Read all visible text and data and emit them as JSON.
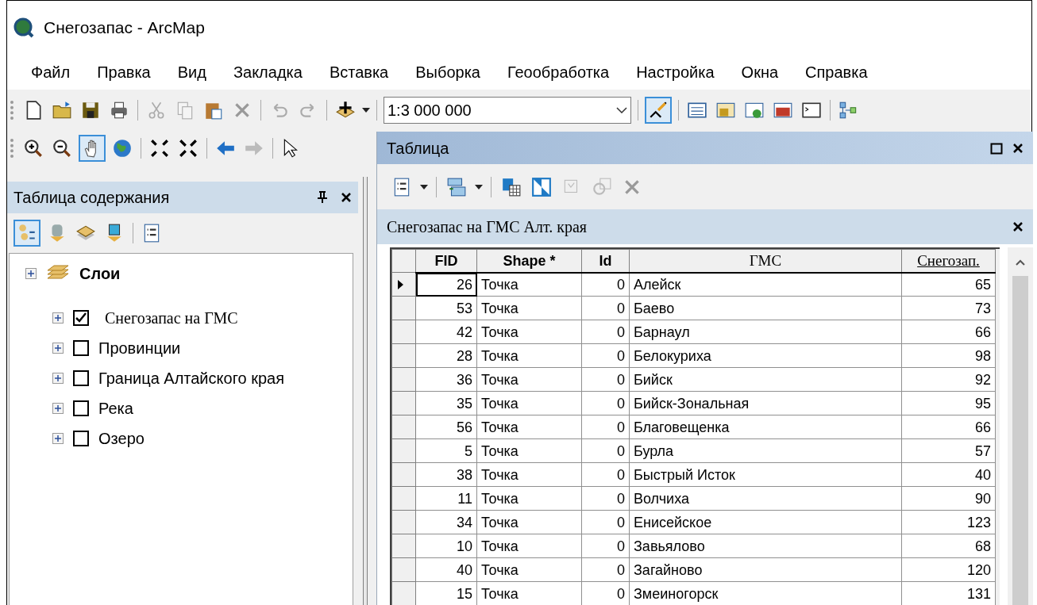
{
  "window": {
    "title": "Снегозапас - ArcMap"
  },
  "menu": [
    "Файл",
    "Правка",
    "Вид",
    "Закладка",
    "Вставка",
    "Выборка",
    "Геообработка",
    "Настройка",
    "Окна",
    "Справка"
  ],
  "scale": {
    "value": "1:3 000 000"
  },
  "toc": {
    "title": "Таблица содержания",
    "root": {
      "label": "Слои",
      "children": [
        {
          "label": "Снегозапас на ГМС",
          "checked": true
        },
        {
          "label": "Провинции",
          "checked": false
        },
        {
          "label": "Граница Алтайского края",
          "checked": false
        },
        {
          "label": "Река",
          "checked": false
        },
        {
          "label": "Озеро",
          "checked": false
        }
      ]
    }
  },
  "table_window": {
    "title": "Таблица",
    "table_name": "Снегозапас на ГМС Алт. края",
    "columns": [
      {
        "label": "FID",
        "kind": "number"
      },
      {
        "label": "Shape *",
        "kind": "text"
      },
      {
        "label": "Id",
        "kind": "number"
      },
      {
        "label": "ГМС",
        "kind": "text"
      },
      {
        "label": "Снегозап.",
        "kind": "number"
      }
    ],
    "rows": [
      {
        "selected": true,
        "cells": [
          "26",
          "Точка",
          "0",
          "Алейск",
          "65"
        ]
      },
      {
        "selected": false,
        "cells": [
          "53",
          "Точка",
          "0",
          "Баево",
          "73"
        ]
      },
      {
        "selected": false,
        "cells": [
          "42",
          "Точка",
          "0",
          "Барнаул",
          "66"
        ]
      },
      {
        "selected": false,
        "cells": [
          "28",
          "Точка",
          "0",
          "Белокуриха",
          "98"
        ]
      },
      {
        "selected": false,
        "cells": [
          "36",
          "Точка",
          "0",
          "Бийск",
          "92"
        ]
      },
      {
        "selected": false,
        "cells": [
          "35",
          "Точка",
          "0",
          "Бийск-Зональная",
          "95"
        ]
      },
      {
        "selected": false,
        "cells": [
          "56",
          "Точка",
          "0",
          "Благовещенка",
          "66"
        ]
      },
      {
        "selected": false,
        "cells": [
          "5",
          "Точка",
          "0",
          "Бурла",
          "57"
        ]
      },
      {
        "selected": false,
        "cells": [
          "38",
          "Точка",
          "0",
          "Быстрый Исток",
          "40"
        ]
      },
      {
        "selected": false,
        "cells": [
          "11",
          "Точка",
          "0",
          "Волчиха",
          "90"
        ]
      },
      {
        "selected": false,
        "cells": [
          "34",
          "Точка",
          "0",
          "Енисейское",
          "123"
        ]
      },
      {
        "selected": false,
        "cells": [
          "10",
          "Точка",
          "0",
          "Завьялово",
          "68"
        ]
      },
      {
        "selected": false,
        "cells": [
          "40",
          "Точка",
          "0",
          "Загайново",
          "120"
        ]
      },
      {
        "selected": false,
        "cells": [
          "15",
          "Точка",
          "0",
          "Змеиногорск",
          "131"
        ]
      }
    ]
  }
}
